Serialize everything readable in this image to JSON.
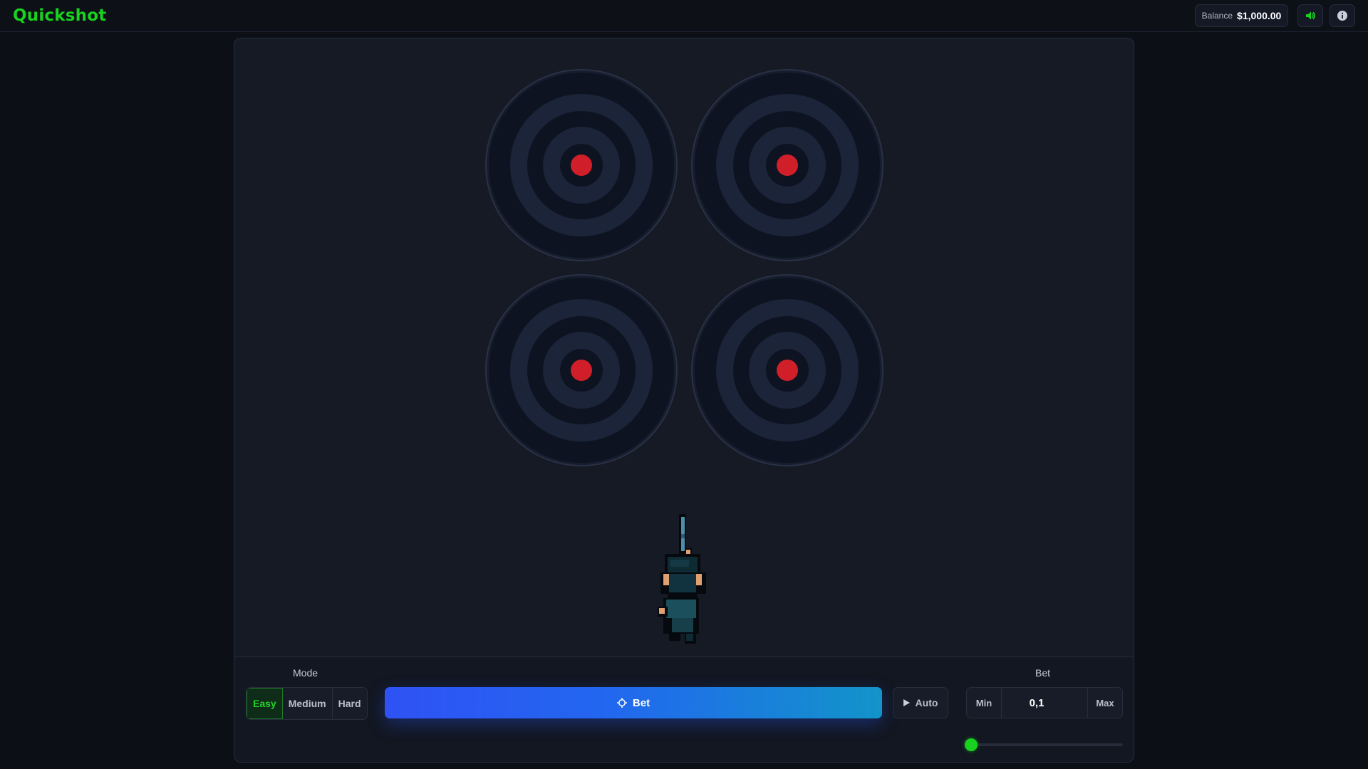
{
  "app": {
    "title": "Quickshot"
  },
  "header": {
    "balance_label": "Balance",
    "balance_value": "$1,000.00",
    "sound_icon": "speaker-icon",
    "info_icon": "info-icon"
  },
  "arena": {
    "targets": [
      {
        "name": "target-1"
      },
      {
        "name": "target-2"
      },
      {
        "name": "target-3"
      },
      {
        "name": "target-4"
      }
    ],
    "shooter": "pixel-shooter-character"
  },
  "controls": {
    "mode_label": "Mode",
    "modes": [
      "Easy",
      "Medium",
      "Hard"
    ],
    "active_mode": "Easy",
    "bet_button": "Bet",
    "bet_icon": "crosshair-icon",
    "auto_button": "Auto",
    "auto_icon": "play-icon",
    "bet_label": "Bet",
    "min_label": "Min",
    "max_label": "Max",
    "bet_amount": "0,1",
    "bet_slider_level": 0
  },
  "colors": {
    "accent_green": "#19d11f",
    "bet_gradient_start": "#2f52f5",
    "bet_gradient_end": "#1294c9",
    "bullseye_red": "#d11f2a",
    "panel_bg": "#151a25"
  }
}
